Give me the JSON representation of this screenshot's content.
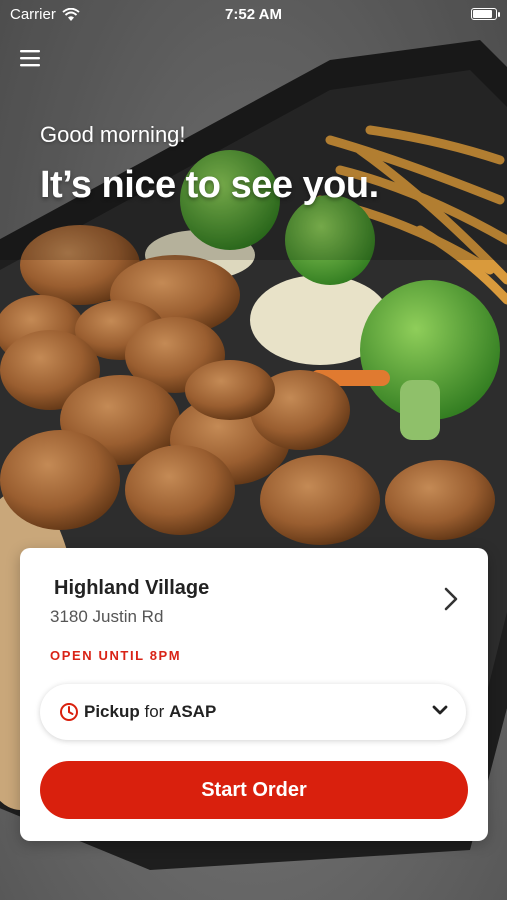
{
  "status_bar": {
    "carrier": "Carrier",
    "time": "7:52 AM",
    "battery_level": 0.95
  },
  "header": {
    "menu_icon": "hamburger-menu-icon"
  },
  "greeting": {
    "line1": "Good morning!",
    "line2": "It’s nice to see you."
  },
  "location_card": {
    "store_name": "Highland Village",
    "address": "3180 Justin Rd",
    "hours": "OPEN UNTIL 8PM",
    "pickup": {
      "mode": "Pickup",
      "connector": "for",
      "when": "ASAP"
    },
    "start_order_label": "Start Order"
  },
  "colors": {
    "accent": "#D9200D",
    "hours_text": "#D92316",
    "card_bg": "#FFFFFF"
  },
  "icons": [
    "wifi-icon",
    "battery-icon",
    "hamburger-menu-icon",
    "chevron-right-icon",
    "clock-icon",
    "chevron-down-icon"
  ],
  "background_image": "bowl of teriyaki chicken with broccoli, noodles and rice"
}
